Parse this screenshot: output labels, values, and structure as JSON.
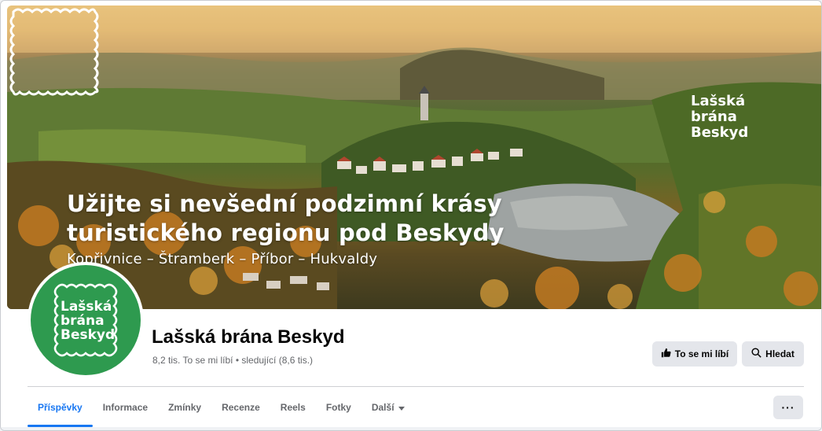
{
  "cover": {
    "headline_line1": "Užijte si nevšední podzimní krásy",
    "headline_line2": "turistického regionu pod Beskydy",
    "subtitle": "Kopřivnice – Štramberk – Příbor – Hukvaldy",
    "stamp_line1": "Lašská",
    "stamp_line2": "brána",
    "stamp_line3": "Beskyd"
  },
  "avatar": {
    "line1": "Lašská",
    "line2": "brána",
    "line3": "Beskyd",
    "color": "#2e9a4f"
  },
  "page": {
    "name": "Lašská brána Beskyd",
    "stats": "8,2 tis. To se mi líbí • sledující (8,6 tis.)"
  },
  "actions": {
    "like_label": "To se mi líbí",
    "like_icon": "thumbs-up-icon",
    "search_label": "Hledat",
    "search_icon": "search-icon",
    "more_label": "···"
  },
  "tabs": [
    {
      "label": "Příspěvky",
      "active": true
    },
    {
      "label": "Informace",
      "active": false
    },
    {
      "label": "Zmínky",
      "active": false
    },
    {
      "label": "Recenze",
      "active": false
    },
    {
      "label": "Reels",
      "active": false
    },
    {
      "label": "Fotky",
      "active": false
    },
    {
      "label": "Další",
      "active": false
    }
  ],
  "colors": {
    "accent": "#1877f2",
    "button_bg": "#e4e6eb",
    "muted_text": "#65676b"
  }
}
